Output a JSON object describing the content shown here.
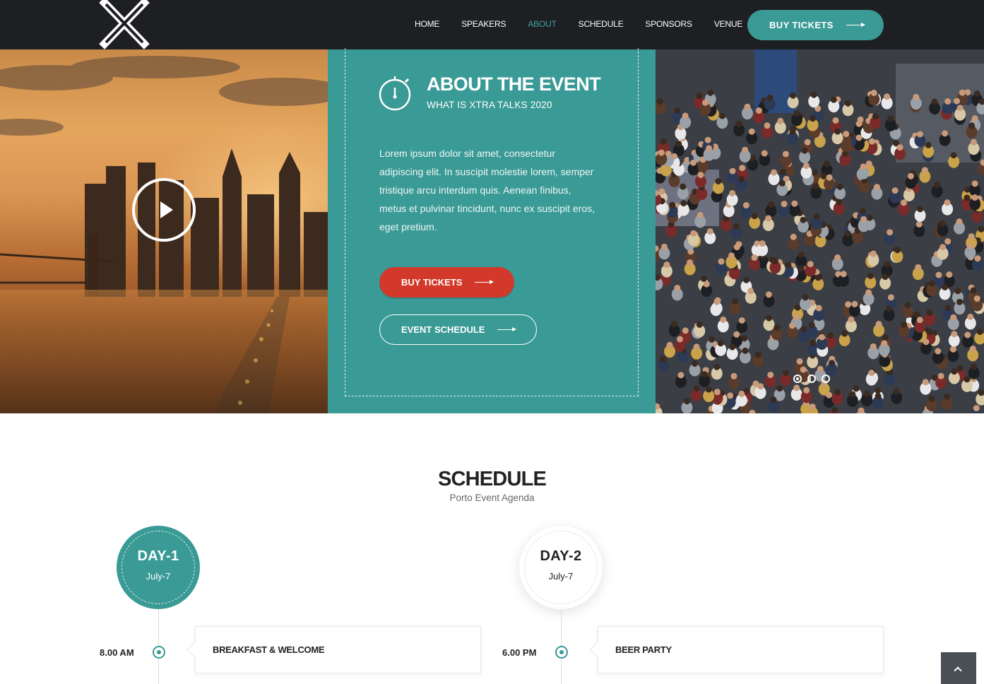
{
  "nav": {
    "items": [
      "HOME",
      "SPEAKERS",
      "ABOUT",
      "SCHEDULE",
      "SPONSORS",
      "VENUE"
    ],
    "active": "ABOUT",
    "cta_label": "BUY TICKETS"
  },
  "hero": {
    "about_title": "ABOUT THE EVENT",
    "about_subtitle": "WHAT IS XTRA TALKS 2020",
    "about_text": "Lorem ipsum dolor sit amet, consectetur adipiscing elit. In suscipit molestie lorem, semper tristique arcu interdum quis. Aenean finibus, metus et pulvinar tincidunt, nunc ex suscipit eros, eget pretium.",
    "buy_label": "BUY TICKETS",
    "schedule_label": "EVENT SCHEDULE",
    "carousel_active": 1
  },
  "schedule": {
    "title": "SCHEDULE",
    "subtitle": "Porto Event Agenda",
    "days": [
      {
        "name": "DAY-1",
        "date": "July-7",
        "time": "8.00 AM",
        "event": "BREAKFAST & WELCOME"
      },
      {
        "name": "DAY-2",
        "date": "July-7",
        "time": "6.00 PM",
        "event": "BEER PARTY"
      }
    ]
  },
  "colors": {
    "primary": "#3a9a95",
    "danger": "#d2392a",
    "header": "#1d1f22"
  },
  "icons": [
    "logo-x-icon",
    "stopwatch-icon",
    "play-icon",
    "arrow-right-icon",
    "chevron-up-icon"
  ]
}
